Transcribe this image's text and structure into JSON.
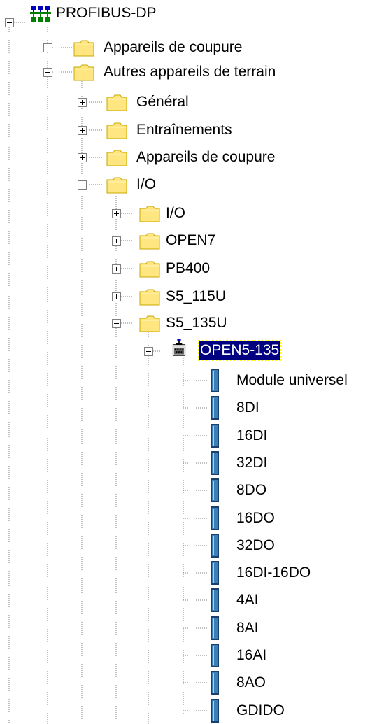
{
  "tree": {
    "root": {
      "label": "PROFIBUS-DP",
      "icon": "network-icon",
      "expanded": true
    },
    "items": [
      {
        "label": "Appareils de coupure",
        "icon": "folder-icon",
        "expanded": false,
        "level": 1
      },
      {
        "label": "Autres appareils de terrain",
        "icon": "folder-icon",
        "expanded": true,
        "level": 1
      },
      {
        "label": "Général",
        "icon": "folder-icon",
        "expanded": false,
        "level": 2
      },
      {
        "label": "Entraînements",
        "icon": "folder-icon",
        "expanded": false,
        "level": 2
      },
      {
        "label": "Appareils de coupure",
        "icon": "folder-icon",
        "expanded": false,
        "level": 2
      },
      {
        "label": "I/O",
        "icon": "folder-icon",
        "expanded": true,
        "level": 2
      },
      {
        "label": "I/O",
        "icon": "folder-icon",
        "expanded": false,
        "level": 3
      },
      {
        "label": "OPEN7",
        "icon": "folder-icon",
        "expanded": false,
        "level": 3
      },
      {
        "label": "PB400",
        "icon": "folder-icon",
        "expanded": false,
        "level": 3
      },
      {
        "label": "S5_115U",
        "icon": "folder-icon",
        "expanded": false,
        "level": 3
      },
      {
        "label": "S5_135U",
        "icon": "folder-icon",
        "expanded": true,
        "level": 3
      },
      {
        "label": "OPEN5-135",
        "icon": "station-icon",
        "expanded": true,
        "selected": true,
        "level": 4
      }
    ],
    "modules": [
      "Module universel",
      "8DI",
      "16DI",
      "32DI",
      "8DO",
      "16DO",
      "32DO",
      "16DI-16DO",
      "4AI",
      "8AI",
      "16AI",
      "8AO",
      "GDIDO"
    ]
  },
  "colors": {
    "folder": "#ffe680",
    "folder_dark": "#c8a800",
    "selection": "#000080",
    "module_blue": "#3a7fb8",
    "module_dark": "#1a3f6a"
  }
}
